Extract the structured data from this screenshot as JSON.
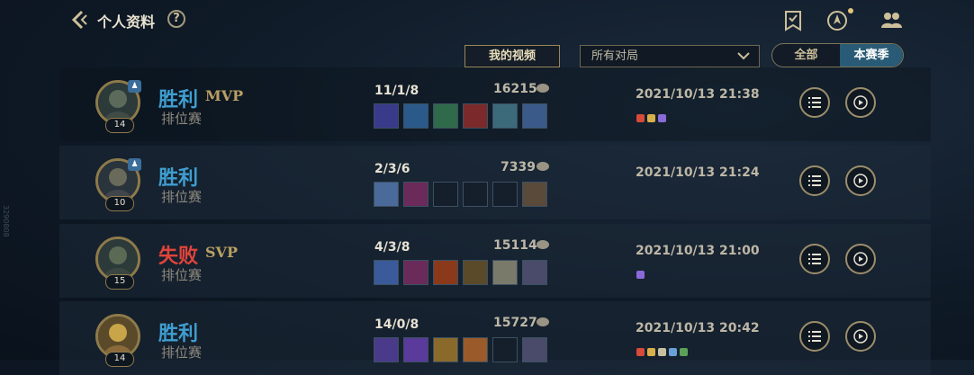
{
  "header": {
    "title": "个人资料",
    "help": "?"
  },
  "controls": {
    "my_video": "我的视频",
    "filter_value": "所有对局",
    "segments": [
      "全部",
      "本赛季"
    ],
    "selected_segment": "本赛季"
  },
  "icons": {
    "back": "back-chevron-icon",
    "help": "help-icon",
    "task": "task-badge-icon",
    "rank": "rank-emblem-icon",
    "friends": "friends-icon",
    "list": "list-detail-icon",
    "play": "replay-play-icon"
  },
  "colors": {
    "win": "#3f9ed0",
    "lose": "#e0443a",
    "accent": "#9a8757",
    "selected_tab": "#2a5b76"
  },
  "matches": [
    {
      "result": "胜利",
      "outcome": "win",
      "title_badge": "MVP",
      "mode": "排位赛",
      "level": "14",
      "party": "♟",
      "kda": "11/1/8",
      "gold": "16215",
      "time": "2021/10/13 21:38"
    },
    {
      "result": "胜利",
      "outcome": "win",
      "title_badge": "",
      "mode": "排位赛",
      "level": "10",
      "party": "♟",
      "kda": "2/3/6",
      "gold": "7339",
      "time": "2021/10/13 21:24"
    },
    {
      "result": "失败",
      "outcome": "lose",
      "title_badge": "SVP",
      "mode": "排位赛",
      "level": "15",
      "party": "",
      "kda": "4/3/8",
      "gold": "15114",
      "time": "2021/10/13 21:00"
    },
    {
      "result": "胜利",
      "outcome": "win",
      "title_badge": "",
      "mode": "排位赛",
      "level": "14",
      "party": "",
      "kda": "14/0/8",
      "gold": "15727",
      "time": "2021/10/13 20:42"
    }
  ],
  "side_tag": "3290808"
}
